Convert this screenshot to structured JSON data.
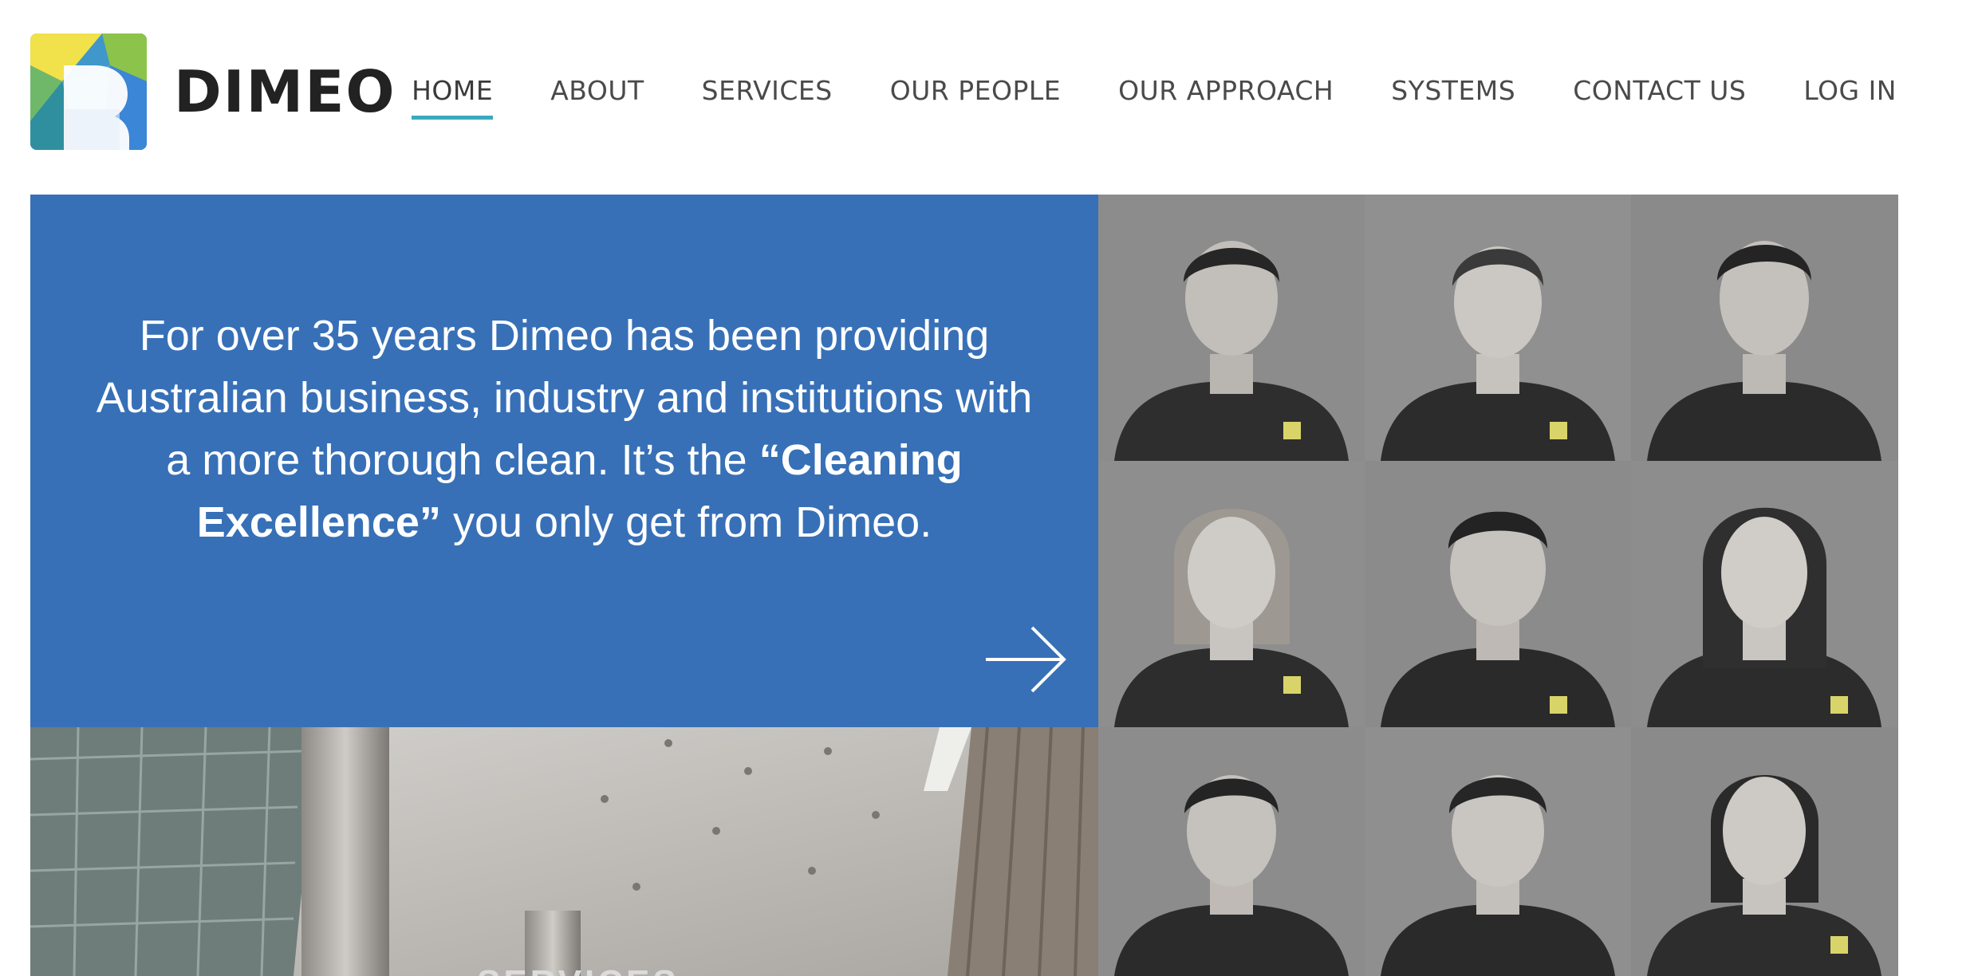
{
  "brand": {
    "name": "DIMEO",
    "logo_icon": "dimeo-logo-icon",
    "colors": {
      "blue": "#3770b7",
      "accent": "#3aa9be",
      "yellow": "#f1e14a",
      "green": "#8cc34a"
    }
  },
  "nav": {
    "items": [
      {
        "label": "HOME",
        "active": true
      },
      {
        "label": "ABOUT",
        "active": false
      },
      {
        "label": "SERVICES",
        "active": false
      },
      {
        "label": "OUR PEOPLE",
        "active": false
      },
      {
        "label": "OUR APPROACH",
        "active": false
      },
      {
        "label": "SYSTEMS",
        "active": false
      },
      {
        "label": "CONTACT US",
        "active": false
      },
      {
        "label": "LOG IN",
        "active": false
      }
    ]
  },
  "hero": {
    "text_part1": "For over 35 years Dimeo has been providing Australian business, industry and institutions with a more thorough clean. It’s the ",
    "text_bold": "“Cleaning Excellence”",
    "text_part2": " you only get from Dimeo.",
    "arrow_icon": "arrow-right-icon"
  },
  "building": {
    "caption": "SERVICES"
  },
  "people": {
    "count": 9
  }
}
